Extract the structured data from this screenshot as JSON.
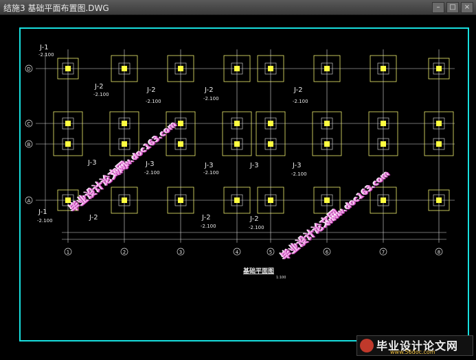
{
  "window": {
    "title": "结施3 基础平面布置图.DWG"
  },
  "colors": {
    "frame": "#18e0e0",
    "grid": "#e0e0e0",
    "footing": "#f0f070",
    "pier": "#ffff40",
    "label": "#e8e8e8"
  },
  "row_axes": [
    "D",
    "C",
    "B",
    "A"
  ],
  "col_axes": [
    "1",
    "2",
    "3",
    "4",
    "5",
    "6",
    "7",
    "8"
  ],
  "labels": {
    "j1_top": "J-1",
    "j1_top_elev": "-2.100",
    "j2_a": "J-2",
    "j2_a_elev": "-2.100",
    "j2_b": "J-2",
    "j2_b_elev": "-2.100",
    "j2_c": "J-2",
    "j2_c_elev": "-2.100",
    "j2_d": "J-2",
    "j2_d_elev": "-2.100",
    "j3_a": "J-3",
    "j3_a_elev": "-2.100",
    "j3_b": "J-3",
    "j3_b_elev": "-2.100",
    "j3_c": "J-3",
    "j3_c_elev": "-2.100",
    "j3_d": "J-3",
    "j3_d_elev": "-2.100",
    "j1_bot": "J-1",
    "j1_bot_elev": "-2.100",
    "j2_e": "J-2",
    "j2_e_elev": "-2.100",
    "j2_f": "J-2",
    "j2_f_elev": "-2.100",
    "j2_g": "J-2",
    "j2_g_elev": "-2.100",
    "plan_title": "基础平面图",
    "plan_scale": "1:100"
  },
  "watermarks": {
    "wm1_cn": "毕业设计论文网",
    "wm1_url": "www.doc163.com",
    "wm2_cn": "毕业设计论文网",
    "wm2_url": "www.doc163.com"
  },
  "footer": {
    "brand": "毕业设计论文网",
    "url": "www.56doc.com"
  }
}
